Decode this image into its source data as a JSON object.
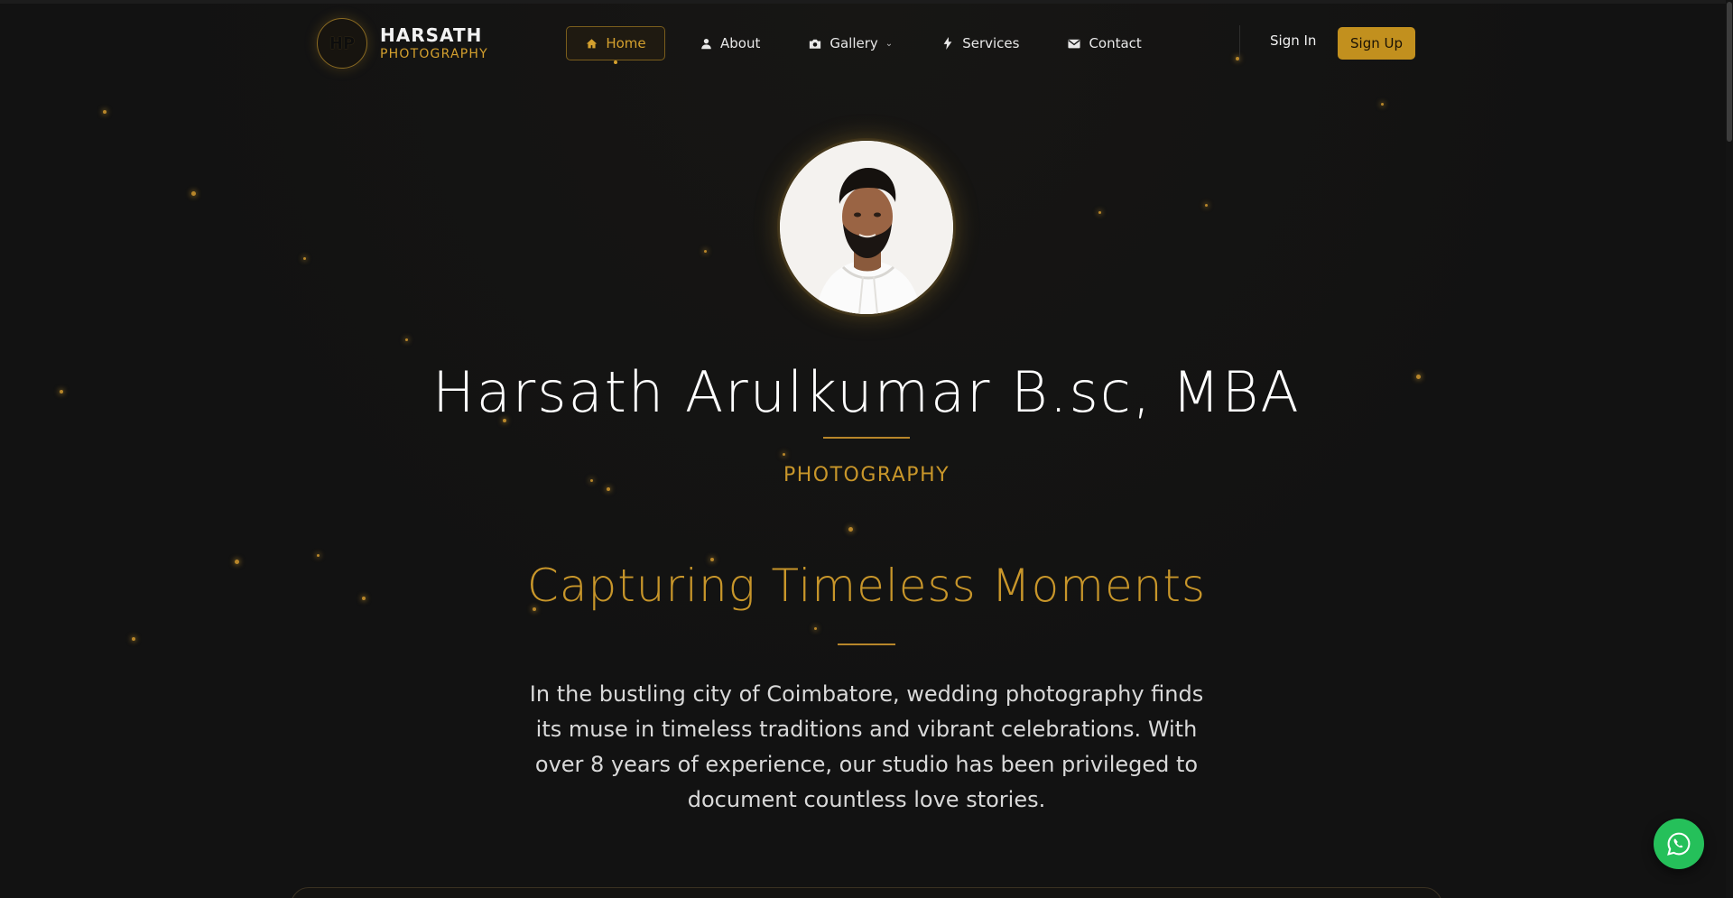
{
  "brand": {
    "initials": "HP",
    "name": "HARSATH",
    "tagline": "PHOTOGRAPHY"
  },
  "nav": {
    "items": [
      {
        "label": "Home",
        "icon": "home-icon",
        "active": true
      },
      {
        "label": "About",
        "icon": "user-icon"
      },
      {
        "label": "Gallery",
        "icon": "camera-icon",
        "dropdown": true
      },
      {
        "label": "Services",
        "icon": "bolt-icon"
      },
      {
        "label": "Contact",
        "icon": "mail-icon"
      }
    ],
    "signin_label": "Sign In",
    "signup_label": "Sign Up"
  },
  "hero": {
    "name": "Harsath Arulkumar B.sc, MBA",
    "subtitle": "PHOTOGRAPHY",
    "headline": "Capturing Timeless Moments",
    "paragraph": "In the bustling city of Coimbatore, wedding photography finds its muse in timeless traditions and vibrant celebrations. With over 8 years of experience, our studio has been privileged to document countless love stories."
  },
  "colors": {
    "accent": "#c8962a",
    "background": "#121212",
    "whatsapp": "#25c05a"
  }
}
